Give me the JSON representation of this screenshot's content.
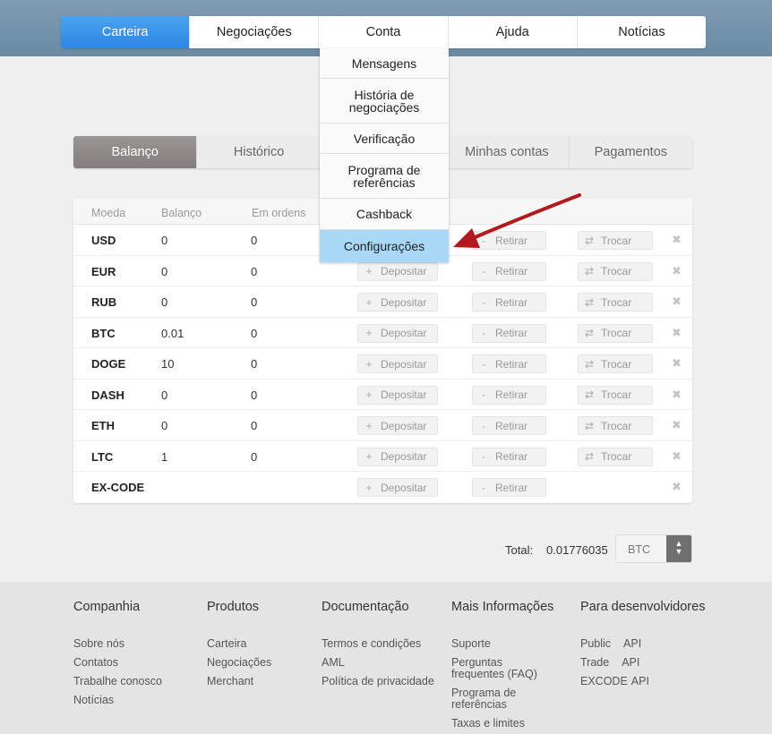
{
  "main_nav": {
    "items": [
      {
        "label": "Carteira",
        "active": true
      },
      {
        "label": "Negociações",
        "active": false
      },
      {
        "label": "Conta",
        "active": false
      },
      {
        "label": "Ajuda",
        "active": false
      },
      {
        "label": "Notícias",
        "active": false
      }
    ]
  },
  "account_menu": {
    "items": [
      {
        "label": "Mensagens"
      },
      {
        "label": "História de negociações"
      },
      {
        "label": "Verificação"
      },
      {
        "label": "Programa de referências"
      },
      {
        "label": "Cashback"
      },
      {
        "label": "Configurações",
        "selected": true
      }
    ]
  },
  "sub_tabs": {
    "items": [
      {
        "label": "Balanço",
        "active": true
      },
      {
        "label": "Histórico"
      },
      {
        "label": ""
      },
      {
        "label": "Minhas contas"
      },
      {
        "label": "Pagamentos"
      }
    ]
  },
  "balance_table": {
    "headers": {
      "coin": "Moeda",
      "balance": "Balanço",
      "orders": "Em ordens"
    },
    "deposit_label": "Depositar",
    "withdraw_label": "Retirar",
    "exchange_label": "Trocar",
    "rows": [
      {
        "coin": "USD",
        "balance": "0",
        "orders": "0"
      },
      {
        "coin": "EUR",
        "balance": "0",
        "orders": "0"
      },
      {
        "coin": "RUB",
        "balance": "0",
        "orders": "0"
      },
      {
        "coin": "BTC",
        "balance": "0.01",
        "orders": "0"
      },
      {
        "coin": "DOGE",
        "balance": "10",
        "orders": "0"
      },
      {
        "coin": "DASH",
        "balance": "0",
        "orders": "0"
      },
      {
        "coin": "ETH",
        "balance": "0",
        "orders": "0"
      },
      {
        "coin": "LTC",
        "balance": "1",
        "orders": "0"
      },
      {
        "coin": "EX-CODE",
        "balance": "",
        "orders": ""
      }
    ]
  },
  "total": {
    "label": "Total:",
    "value": "0.01776035",
    "currency": "BTC"
  },
  "footer": {
    "columns": [
      {
        "title": "Companhia",
        "links": [
          "Sobre nós",
          "Contatos",
          "Trabalhe conosco",
          "Notícias"
        ]
      },
      {
        "title": "Produtos",
        "links": [
          "Carteira",
          "Negociações",
          "Merchant"
        ]
      },
      {
        "title": "Documentação",
        "links": [
          "Termos e condições",
          "AML",
          "Política de privacidade"
        ]
      },
      {
        "title": "Mais Informações",
        "links": [
          "Suporte",
          "Perguntas frequentes (FAQ)",
          "Programa de referências",
          "Taxas e limites"
        ]
      },
      {
        "title": "Para desenvolvidores",
        "links": [
          {
            "name": "Public",
            "api": "API"
          },
          {
            "name": "Trade",
            "api": "API"
          },
          {
            "name": "EXCODE",
            "api": "API"
          }
        ]
      }
    ]
  },
  "colors": {
    "accent_blue": "#2f86e0",
    "menu_highlight": "#a9d8f7",
    "annotation_arrow": "#b3191c"
  }
}
